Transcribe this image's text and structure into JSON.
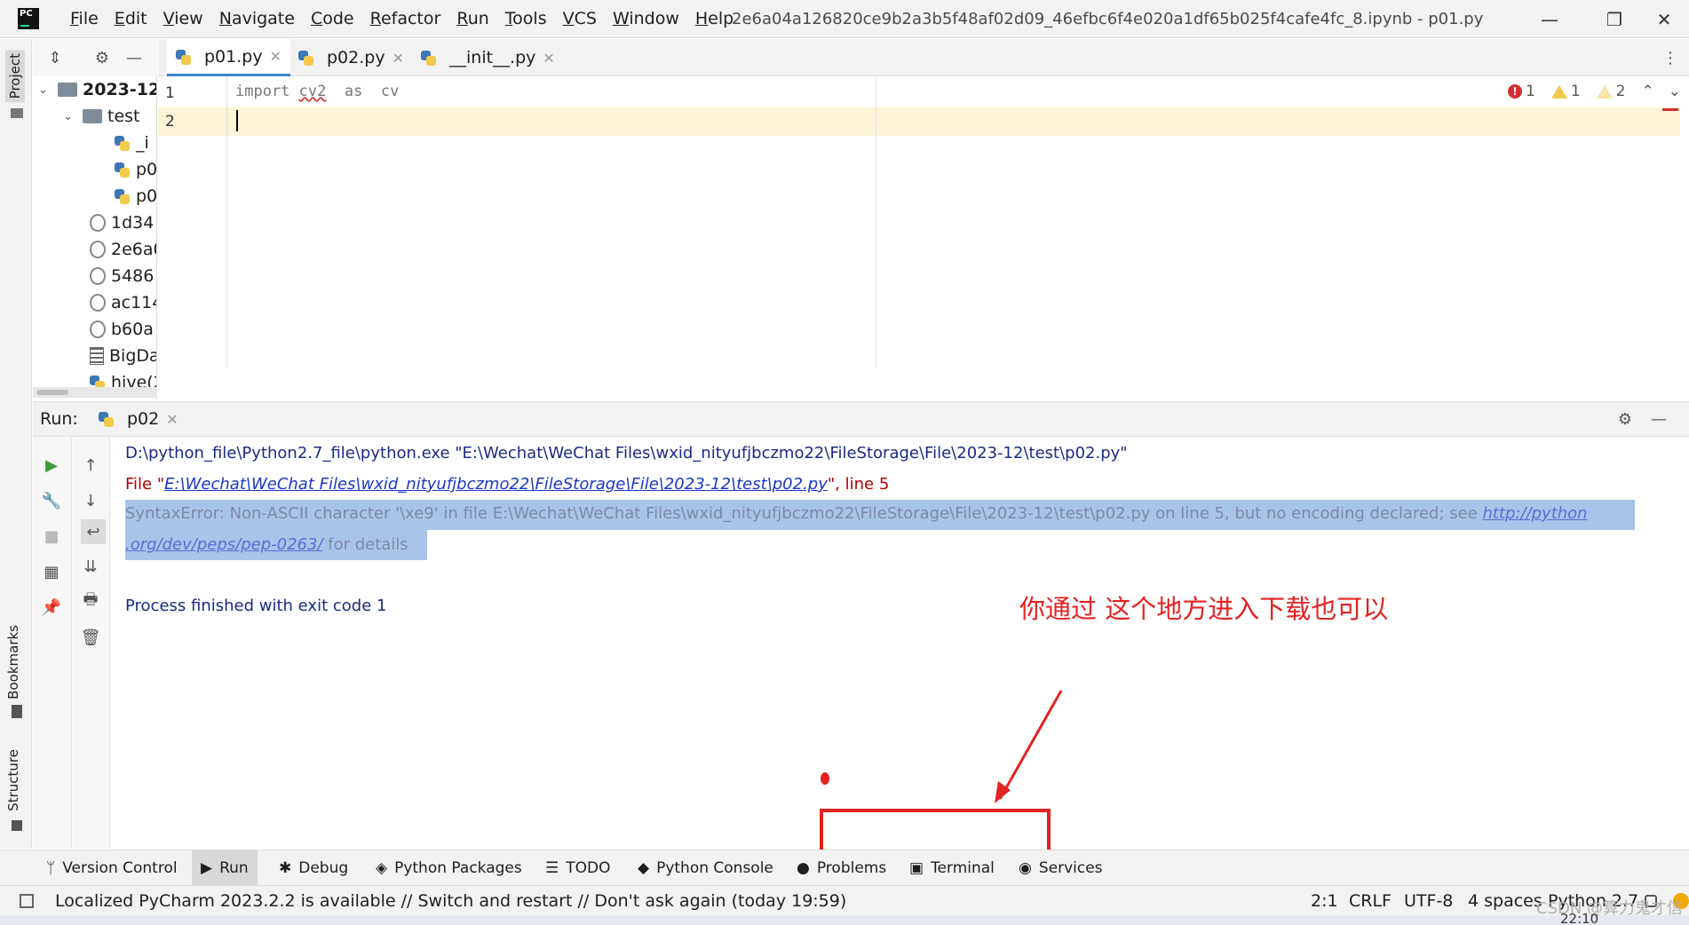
{
  "window": {
    "title": "2e6a04a126820ce9b2a3b5f48af02d09_46efbc6f4e020a1df65b025f4cafe4fc_8.ipynb - p01.py",
    "logo": "PC",
    "minimize": "—",
    "restore": "❐",
    "close": "✕"
  },
  "menu": [
    "File",
    "Edit",
    "View",
    "Navigate",
    "Code",
    "Refactor",
    "Run",
    "Tools",
    "VCS",
    "Window",
    "Help"
  ],
  "left_stripe": {
    "project": "Project",
    "bookmarks": "Bookmarks",
    "structure": "Structure"
  },
  "project_tree": {
    "root": "2023-12",
    "folder": "test",
    "files": [
      "_i",
      "p0",
      "p0"
    ],
    "other_items": [
      "1d34",
      "2e6a0",
      "5486",
      "ac114",
      "b60a",
      "BigDa",
      "hive(2"
    ]
  },
  "editor": {
    "tabs": [
      {
        "label": "p01.py",
        "active": true
      },
      {
        "label": "p02.py",
        "active": false
      },
      {
        "label": "__init__.py",
        "active": false
      }
    ],
    "lines": [
      "1",
      "2"
    ],
    "code": {
      "kw": "import",
      "mod": "cv2",
      "as": "as",
      "alias": "cv"
    },
    "inspections": {
      "errors": "1",
      "warnings": "1",
      "weak": "2"
    }
  },
  "run": {
    "label": "Run:",
    "config": "p02",
    "cmd": "D:\\python_file\\Python2.7_file\\python.exe \"E:\\Wechat\\WeChat Files\\wxid_nityufjbczmo22\\FileStorage\\File\\2023-12\\test\\p02.py\"",
    "file_prefix": "  File \"",
    "file_link": "E:\\Wechat\\WeChat Files\\wxid_nityufjbczmo22\\FileStorage\\File\\2023-12\\test\\p02.py",
    "file_suffix": "\", line 5",
    "error_text": "SyntaxError: Non-ASCII character '\\xe9' in file E:\\Wechat\\WeChat Files\\wxid_nityufjbczmo22\\FileStorage\\File\\2023-12\\test\\p02.py on line 5, but no encoding declared; see ",
    "error_link1": "http://python",
    "error_link2": ".org/dev/peps/pep-0263/",
    "error_tail": " for details",
    "exit": "Process finished with exit code 1"
  },
  "annotation": "你通过 这个地方进入下载也可以",
  "bottom_tools": [
    "Version Control",
    "Run",
    "Debug",
    "Python Packages",
    "TODO",
    "Python Console",
    "Problems",
    "Terminal",
    "Services"
  ],
  "status": {
    "message": "Localized PyCharm 2023.2.2 is available // Switch and restart // Don't ask again (today 19:59)",
    "position": "2:1",
    "line_sep": "CRLF",
    "encoding": "UTF-8",
    "indent": "4 spaces",
    "interpreter": "Python 2.7"
  },
  "watermark": "CSDN @算力鬼才信",
  "clock": "22:10",
  "colors": {
    "accent": "#4083c9",
    "annotation": "#e42222",
    "error": "#d32f2f"
  }
}
